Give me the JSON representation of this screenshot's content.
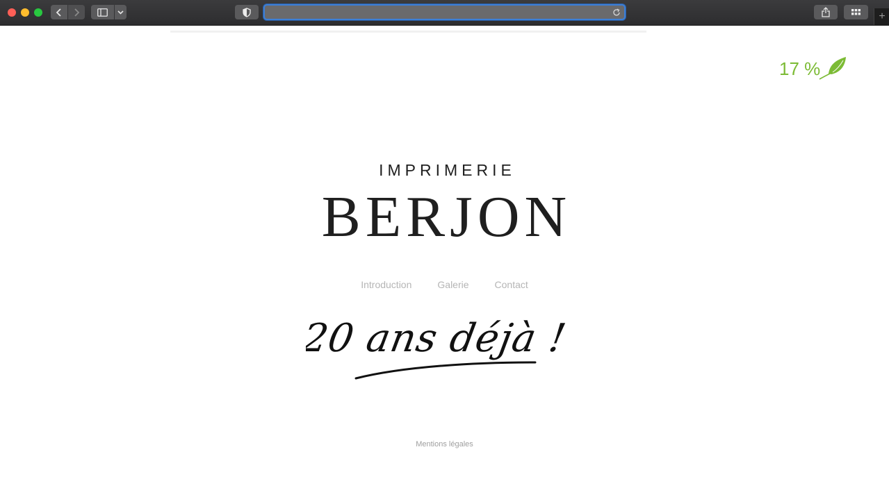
{
  "browser": {
    "address_value": "",
    "address_placeholder": "",
    "new_tab_label": "+"
  },
  "eco_badge": {
    "text": "17 %",
    "color": "#7cbb35",
    "icon": "leaf-icon"
  },
  "brand": {
    "subtitle": "IMPRIMERIE",
    "title": "BERJON"
  },
  "nav": {
    "items": [
      "Introduction",
      "Galerie",
      "Contact"
    ]
  },
  "slogan": {
    "text": "20 ans déjà !"
  },
  "footer": {
    "legal_link": "Mentions légales"
  }
}
